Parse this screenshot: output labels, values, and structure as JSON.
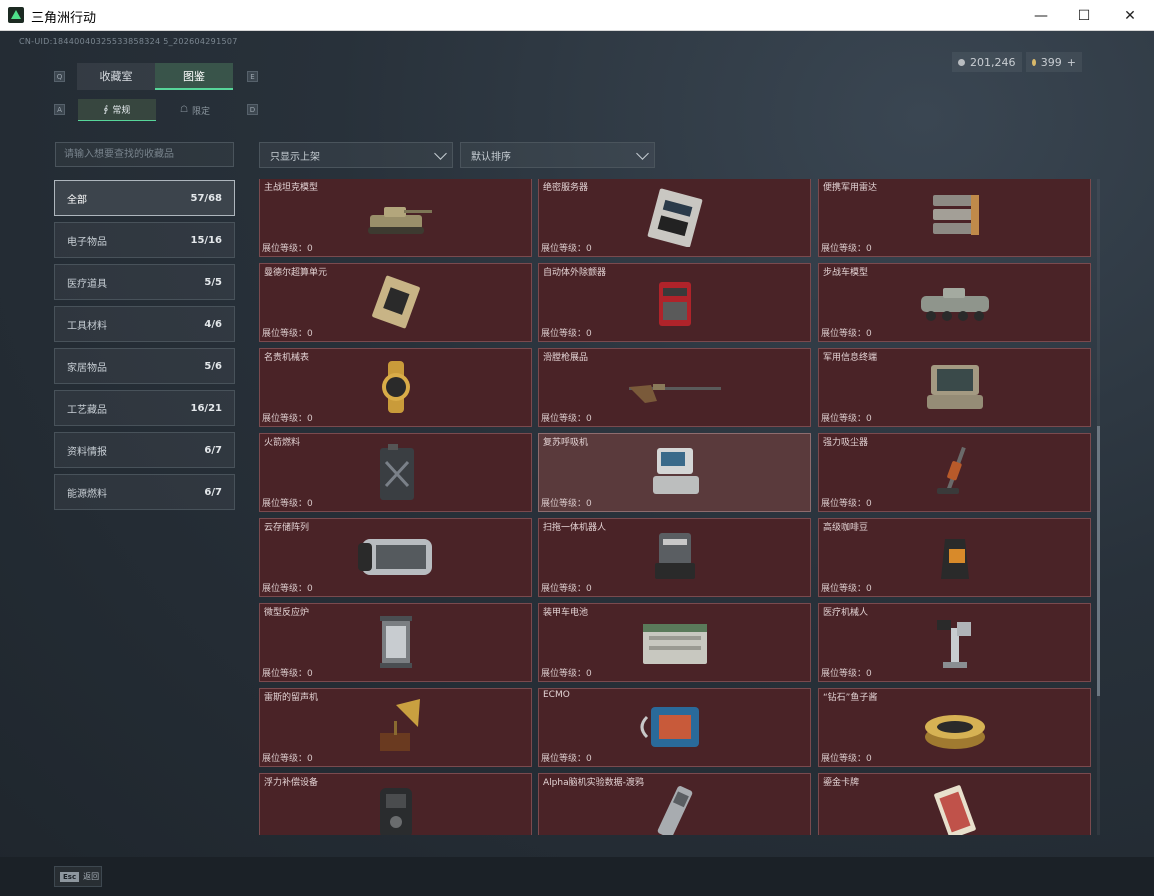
{
  "window": {
    "title": "三角洲行动",
    "minimize": "—",
    "maximize": "☐",
    "close": "✕"
  },
  "uid": "CN-UID:18440040325533858324 5_202604291507",
  "currency": [
    {
      "value": "201,246",
      "color": "#b8bcc0"
    },
    {
      "value": "399",
      "plus": "+",
      "color": "#d8b86a"
    }
  ],
  "key_hints": {
    "q": "Q",
    "e": "E",
    "a": "A",
    "d": "D"
  },
  "main_tabs": [
    {
      "label": "收藏室"
    },
    {
      "label": "图鉴"
    }
  ],
  "sub_tabs": [
    {
      "label": "常规",
      "icon": "∮"
    },
    {
      "label": "限定",
      "icon": "☖"
    }
  ],
  "search": {
    "placeholder": "请输入想要查找的收藏品"
  },
  "filters": {
    "shelf": "只显示上架",
    "sort": "默认排序"
  },
  "categories": [
    {
      "label": "全部",
      "count": "57/68"
    },
    {
      "label": "电子物品",
      "count": "15/16"
    },
    {
      "label": "医疗道具",
      "count": "5/5"
    },
    {
      "label": "工具材料",
      "count": "4/6"
    },
    {
      "label": "家居物品",
      "count": "5/6"
    },
    {
      "label": "工艺藏品",
      "count": "16/21"
    },
    {
      "label": "资料情报",
      "count": "6/7"
    },
    {
      "label": "能源燃料",
      "count": "6/7"
    }
  ],
  "level_label": "展位等级：0",
  "items": [
    {
      "name": "主战坦克模型",
      "icon": "tank-icon"
    },
    {
      "name": "绝密服务器",
      "icon": "server-icon"
    },
    {
      "name": "便携军用雷达",
      "icon": "radar-icon"
    },
    {
      "name": "曼德尔超算单元",
      "icon": "processor-icon"
    },
    {
      "name": "自动体外除颤器",
      "icon": "defibrillator-icon"
    },
    {
      "name": "步战车模型",
      "icon": "ifv-icon"
    },
    {
      "name": "名贵机械表",
      "icon": "watch-icon"
    },
    {
      "name": "滑膛枪展品",
      "icon": "musket-icon"
    },
    {
      "name": "军用信息终端",
      "icon": "terminal-icon"
    },
    {
      "name": "火箭燃料",
      "icon": "fuel-icon"
    },
    {
      "name": "复苏呼吸机",
      "icon": "ventilator-icon"
    },
    {
      "name": "强力吸尘器",
      "icon": "vacuum-icon"
    },
    {
      "name": "云存储阵列",
      "icon": "storage-icon"
    },
    {
      "name": "扫拖一体机器人",
      "icon": "robot-icon"
    },
    {
      "name": "高级咖啡豆",
      "icon": "coffee-icon"
    },
    {
      "name": "微型反应炉",
      "icon": "reactor-icon"
    },
    {
      "name": "装甲车电池",
      "icon": "battery-icon"
    },
    {
      "name": "医疗机械人",
      "icon": "medbot-icon"
    },
    {
      "name": "雷斯的留声机",
      "icon": "gramophone-icon"
    },
    {
      "name": "ECMO",
      "icon": "ecmo-icon"
    },
    {
      "name": "“钻石”鱼子酱",
      "icon": "caviar-icon"
    },
    {
      "name": "浮力补偿设备",
      "icon": "bcd-icon"
    },
    {
      "name": "Alpha脑机实验数据-渡鸦",
      "icon": "datadrive-icon"
    },
    {
      "name": "鎏金卡牌",
      "icon": "card-icon"
    }
  ],
  "back": {
    "key": "Esc",
    "label": "返回"
  }
}
